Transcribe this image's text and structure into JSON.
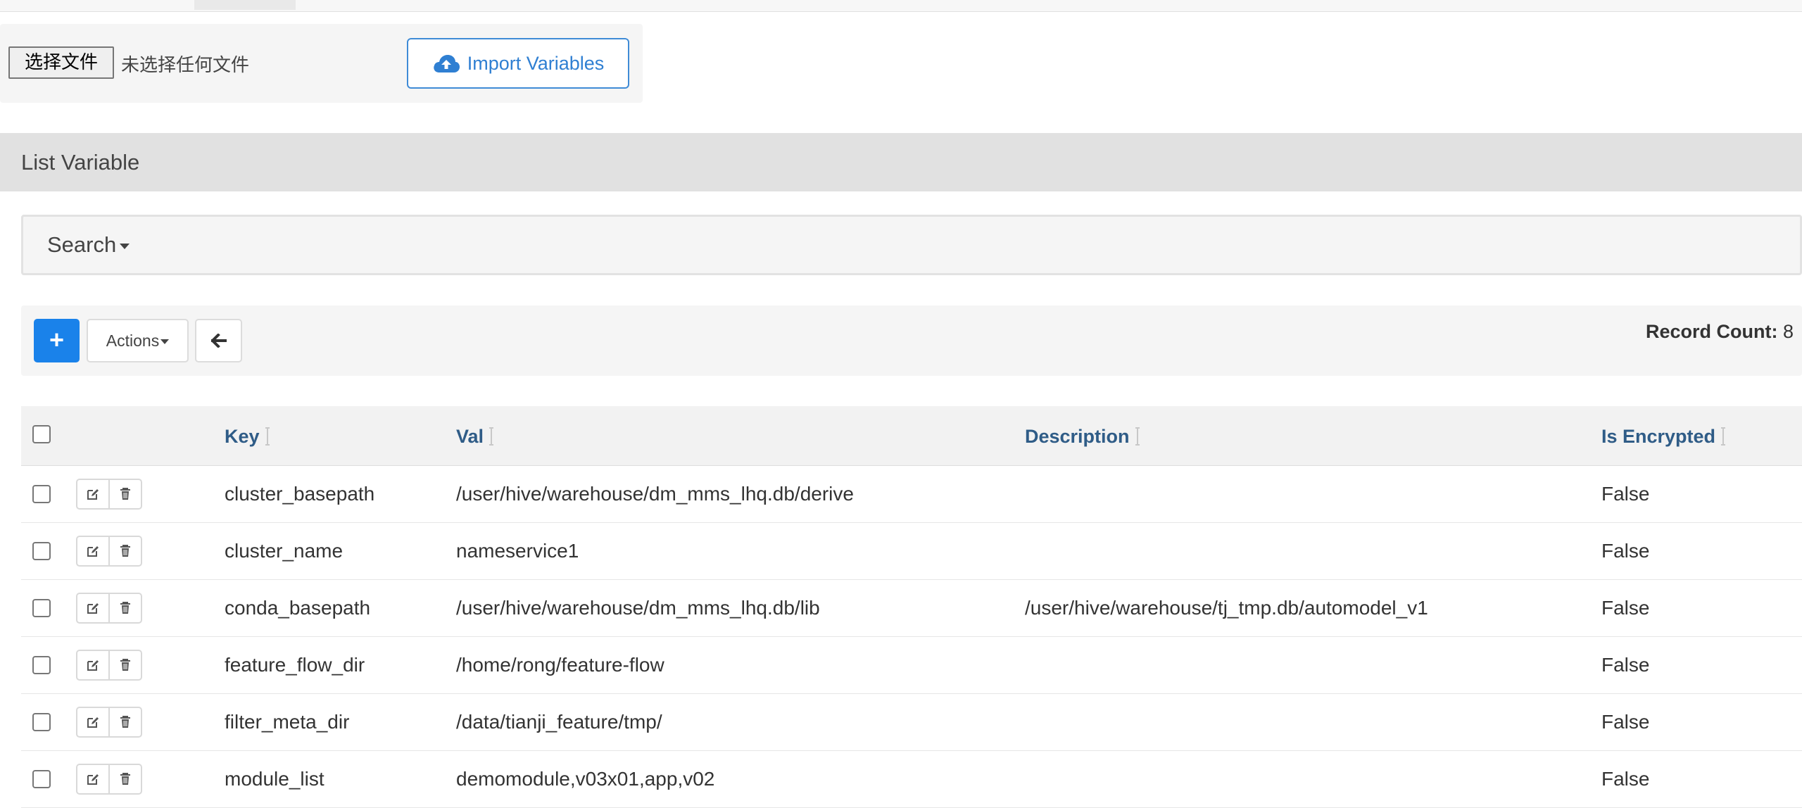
{
  "import": {
    "file_button": "选择文件",
    "file_status": "未选择任何文件",
    "import_button": "Import Variables"
  },
  "panel": {
    "title": "List Variable"
  },
  "search": {
    "label": "Search"
  },
  "toolbar": {
    "add_label": "+",
    "actions_label": "Actions",
    "record_count_label": "Record Count:",
    "record_count": "8"
  },
  "table": {
    "headers": {
      "key": "Key",
      "val": "Val",
      "description": "Description",
      "is_encrypted": "Is Encrypted"
    },
    "rows": [
      {
        "key": "cluster_basepath",
        "val": "/user/hive/warehouse/dm_mms_lhq.db/derive",
        "description": "",
        "is_encrypted": "False"
      },
      {
        "key": "cluster_name",
        "val": "nameservice1",
        "description": "",
        "is_encrypted": "False"
      },
      {
        "key": "conda_basepath",
        "val": "/user/hive/warehouse/dm_mms_lhq.db/lib",
        "description": "/user/hive/warehouse/tj_tmp.db/automodel_v1",
        "is_encrypted": "False"
      },
      {
        "key": "feature_flow_dir",
        "val": "/home/rong/feature-flow",
        "description": "",
        "is_encrypted": "False"
      },
      {
        "key": "filter_meta_dir",
        "val": "/data/tianji_feature/tmp/",
        "description": "",
        "is_encrypted": "False"
      },
      {
        "key": "module_list",
        "val": "demomodule,v03x01,app,v02",
        "description": "",
        "is_encrypted": "False"
      }
    ]
  },
  "icons": {
    "import": "cloud-upload-icon",
    "back": "arrow-left-icon",
    "edit": "edit-icon",
    "delete": "trash-icon"
  },
  "colors": {
    "primary": "#1a82ea",
    "link": "#2f7fd2",
    "header_text": "#2f5c87",
    "panel_bg": "#e1e1e1"
  }
}
